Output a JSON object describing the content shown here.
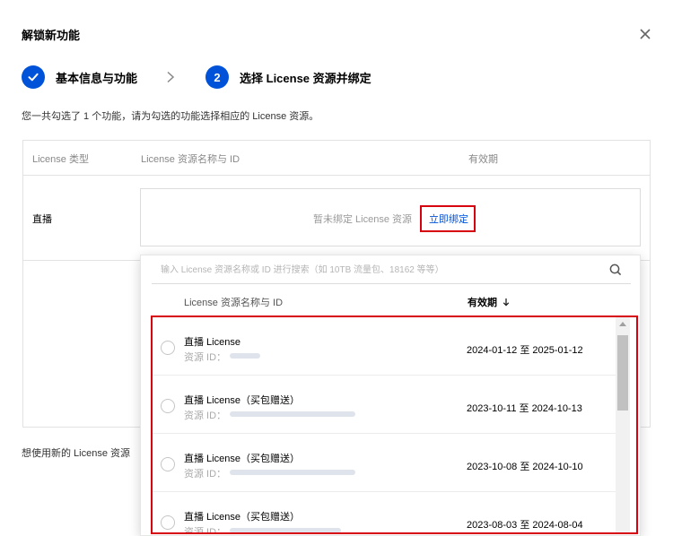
{
  "dialog": {
    "title": "解锁新功能",
    "close_icon": "close-icon"
  },
  "steps": [
    {
      "state": "done",
      "icon": "check-icon",
      "label": "基本信息与功能"
    },
    {
      "state": "active",
      "number": "2",
      "label": "选择 License 资源并绑定"
    }
  ],
  "summary": "您一共勾选了 1 个功能，请为勾选的功能选择相应的 License 资源。",
  "table": {
    "headers": {
      "type": "License 类型",
      "name": "License 资源名称与 ID",
      "period": "有效期"
    },
    "row": {
      "type": "直播",
      "empty_text": "暂未绑定 License 资源",
      "bind_link": "立即绑定"
    }
  },
  "footer_text": "想使用新的 License 资源",
  "dropdown": {
    "search_placeholder": "输入 License 资源名称或 ID 进行搜索（如 10TB 流量包、18162 等等）",
    "headers": {
      "name": "License 资源名称与 ID",
      "period": "有效期"
    },
    "id_label": "资源 ID：",
    "items": [
      {
        "name": "直播 License",
        "period": "2024-01-12 至 2025-01-12"
      },
      {
        "name": "直播 License（买包赠送）",
        "period": "2023-10-11 至 2024-10-13"
      },
      {
        "name": "直播 License（买包赠送）",
        "period": "2023-10-08 至 2024-10-10"
      },
      {
        "name": "直播 License（买包赠送）",
        "period": "2023-08-03 至 2024-08-04"
      }
    ]
  },
  "colors": {
    "primary": "#0052d9",
    "highlight": "#d6000f",
    "border": "#e2e2e2"
  }
}
